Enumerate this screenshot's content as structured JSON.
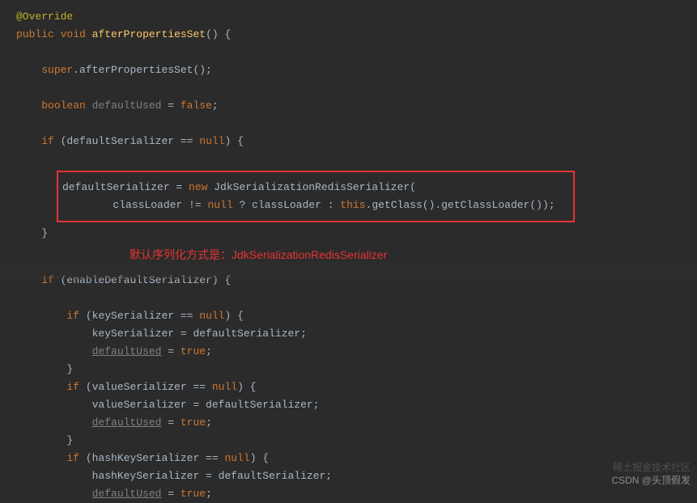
{
  "code": {
    "annotation": "@Override",
    "public": "public",
    "void": "void",
    "method": "afterPropertiesSet",
    "parens": "()",
    "brace_open": " {",
    "super_call_super": "super",
    "super_call_rest": ".afterPropertiesSet();",
    "boolean_kw": "boolean",
    "defaultUsed1": " defaultUsed",
    "assign1": " = ",
    "false_kw": "false",
    "semi": ";",
    "if_kw": "if",
    "if1_cond": " (defaultSerializer == ",
    "null_kw": "null",
    "if1_close": ") {",
    "box_l1_a": "defaultSerializer = ",
    "box_l1_new": "new",
    "box_l1_b": " JdkSerializationRedisSerializer(",
    "box_l2_a": "classLoader != ",
    "box_l2_b": " ? classLoader : ",
    "box_l2_this": "this",
    "box_l2_c": ".getClass().getClassLoader());",
    "close_brace": "}",
    "annotation_cn_prefix": "默认序列化方式是：",
    "annotation_cn_class": "JdkSerializationRedisSerializer",
    "if2_cond": " (enableDefaultSerializer) {",
    "if3_cond": " (keySerializer == ",
    "if3_body": "keySerializer = defaultSerializer;",
    "du_assign_a": "defaultUsed",
    "du_assign_b": " = ",
    "true_kw": "true",
    "if4_cond": " (valueSerializer == ",
    "if4_body": "valueSerializer = defaultSerializer;",
    "if5_cond": " (hashKeySerializer == ",
    "if5_body": "hashKeySerializer = defaultSerializer;"
  },
  "watermarks": {
    "right": "稀土掘金技术社区",
    "bottom": "CSDN @头顶假发"
  }
}
